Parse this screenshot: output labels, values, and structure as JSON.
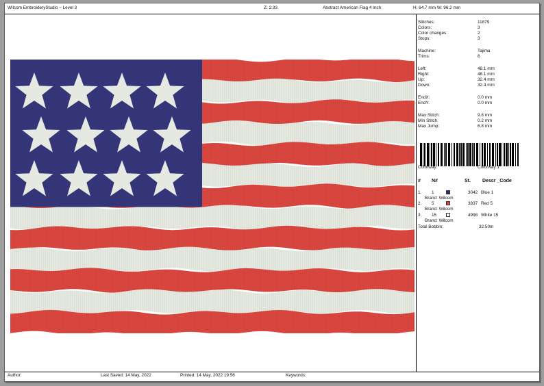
{
  "header": {
    "app_title": "Wilcom EmbroideryStudio – Level 3",
    "zoom": "Z: 2:33",
    "design_name": "Abstract American Flag 4 Inch",
    "dimensions": "H: 64.7 mm   W: 96.2 mm"
  },
  "stats": {
    "stitches_label": "Stitches:",
    "stitches_value": "11879",
    "colors_label": "Colors:",
    "colors_value": "3",
    "color_changes_label": "Color changes:",
    "color_changes_value": "2",
    "stops_label": "Stops:",
    "stops_value": "3",
    "machine_label": "Machine:",
    "machine_value": "Tajima",
    "trims_label": "Trims:",
    "trims_value": "6",
    "left_label": "Left:",
    "left_value": "48.1 mm",
    "right_label": "Right:",
    "right_value": "48.1 mm",
    "up_label": "Up:",
    "up_value": "32.4 mm",
    "down_label": "Down:",
    "down_value": "32.4 mm",
    "endx_label": "EndX:",
    "endx_value": "0.0 mm",
    "endy_label": "EndY:",
    "endy_value": "0.0 mm",
    "max_stitch_label": "Max Stitch:",
    "max_stitch_value": "9.8 mm",
    "min_stitch_label": "Min Stitch:",
    "min_stitch_value": "0.2 mm",
    "max_jump_label": "Max Jump:",
    "max_jump_value": "6.8 mm"
  },
  "colorway": {
    "label": "Colorway:",
    "value": "Colorway 1"
  },
  "table": {
    "headers": {
      "num": "#",
      "needle": "N#",
      "stitches": "St.",
      "descr": "Descr _Code"
    },
    "rows": [
      {
        "num": "1.",
        "needle": "1",
        "color": "#2b2a6e",
        "stitches": "3042",
        "descr": "Blue 1",
        "brand": "Brand: Wilcom"
      },
      {
        "num": "2.",
        "needle": "5",
        "color": "#d9463f",
        "stitches": "3837",
        "descr": "Red 5",
        "brand": "Brand: Wilcom"
      },
      {
        "num": "3.",
        "needle": "15",
        "color": "#ffffff",
        "stitches": "4998",
        "descr": "White 15",
        "brand": "Brand: Wilcom"
      }
    ],
    "total_bobbin_label": "Total Bobbin:",
    "total_bobbin_value": "32.50m"
  },
  "footer": {
    "author": "Author:",
    "last_saved": "Last Saved: 14 May, 2022",
    "printed": "Printed: 14 May, 2022 19:56",
    "keywords": "Keywords:"
  },
  "colors": {
    "blue": "#35357a",
    "red": "#d9463f",
    "white": "#e4e8df",
    "star": "#e6e8e2"
  }
}
